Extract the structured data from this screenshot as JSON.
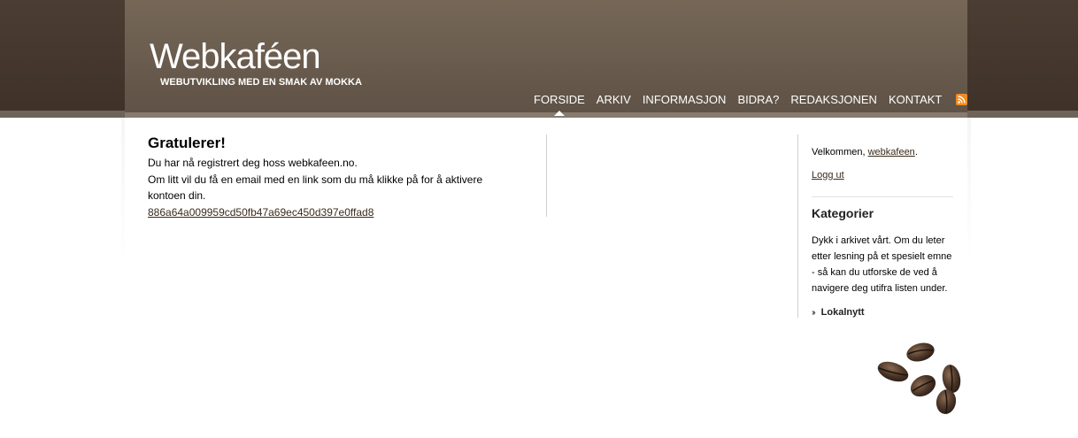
{
  "header": {
    "site_title": "Webkaféen",
    "tagline": "WEBUTVIKLING MED EN SMAK AV MOKKA"
  },
  "nav": {
    "items": [
      {
        "label": "FORSIDE",
        "active": true
      },
      {
        "label": "ARKIV",
        "active": false
      },
      {
        "label": "INFORMASJON",
        "active": false
      },
      {
        "label": "BIDRA?",
        "active": false
      },
      {
        "label": "REDAKSJONEN",
        "active": false
      },
      {
        "label": "KONTAKT",
        "active": false
      }
    ],
    "rss_icon": "rss-icon"
  },
  "main": {
    "heading": "Gratulerer!",
    "line1": "Du har nå registrert deg hoss webkafeen.no.",
    "line2": "Om litt vil du få en email med en link som du må klikke på for å aktivere kontoen din.",
    "activation_link": "886a64a009959cd50fb47a69ec450d397e0ffad8"
  },
  "sidebar": {
    "welcome_prefix": "Velkommen, ",
    "username": "webkafeen",
    "welcome_suffix": ".",
    "logout": "Logg ut",
    "categories_heading": "Kategorier",
    "categories_desc": "Dykk i arkivet vårt. Om du leter etter lesning på et spesielt emne - så kan du utforske de ved å navigere deg utifra listen under.",
    "categories": [
      "Lokalnytt"
    ]
  },
  "colors": {
    "header_brown": "#6b5d4f",
    "outer_brown": "#45382e",
    "link_brown": "#3b2a1a",
    "rss_orange": "#f28b20"
  }
}
